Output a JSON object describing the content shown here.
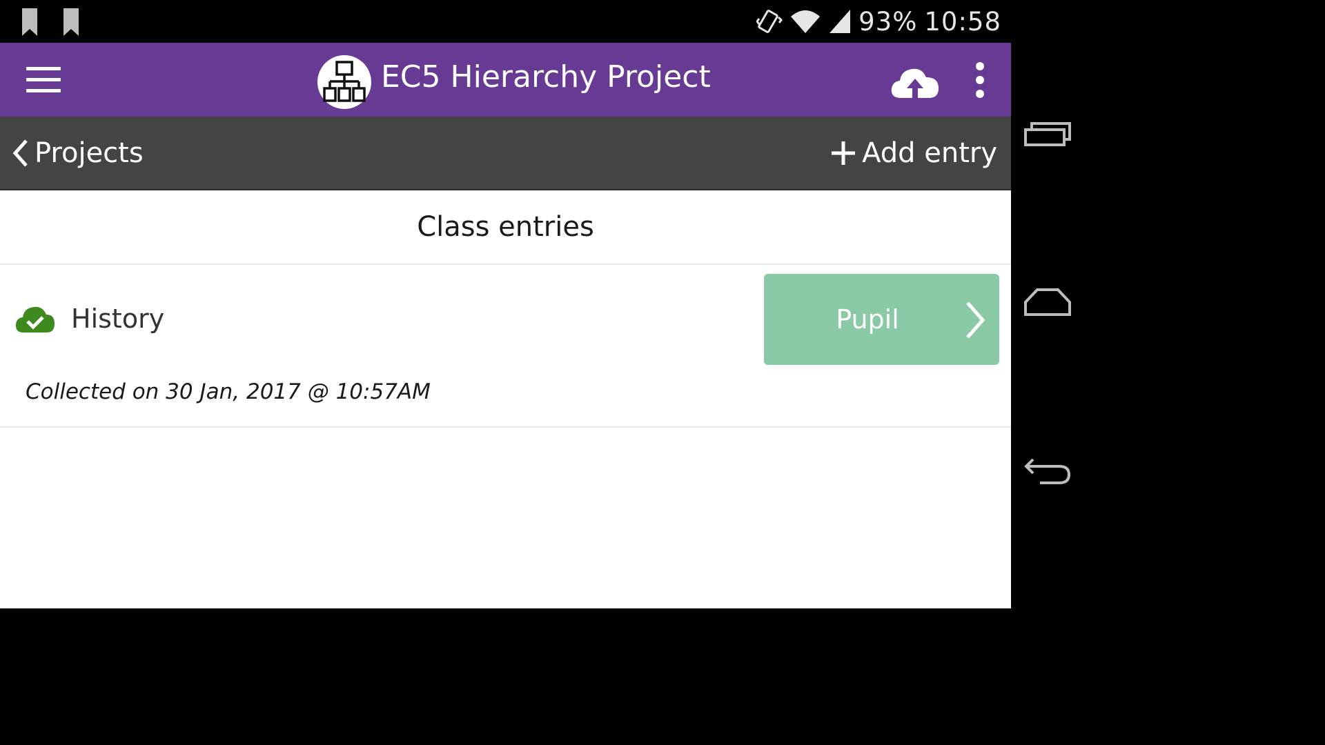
{
  "status_bar": {
    "battery": "93%",
    "time": "10:58",
    "icons": [
      "bookmark-icon",
      "bookmark-icon",
      "vibrate-icon",
      "wifi-icon",
      "signal-icon"
    ]
  },
  "app_bar": {
    "title": "EC5 Hierarchy Project",
    "icons": [
      "menu-icon",
      "hierarchy-logo-icon",
      "cloud-upload-icon",
      "more-vert-icon"
    ],
    "color": "#673a93"
  },
  "nav_bar": {
    "back_label": "Projects",
    "add_label": "Add entry",
    "color": "#444444"
  },
  "section": {
    "title": "Class entries"
  },
  "entries": [
    {
      "title": "History",
      "status_icon": "cloud-check-icon",
      "child_button_label": "Pupil",
      "collected": "Collected on 30 Jan, 2017 @ 10:57AM"
    }
  ],
  "colors": {
    "child_button": "#89c9a5",
    "synced": "#3f8a1e"
  },
  "system_nav": [
    "recents-icon",
    "home-icon",
    "back-icon"
  ]
}
